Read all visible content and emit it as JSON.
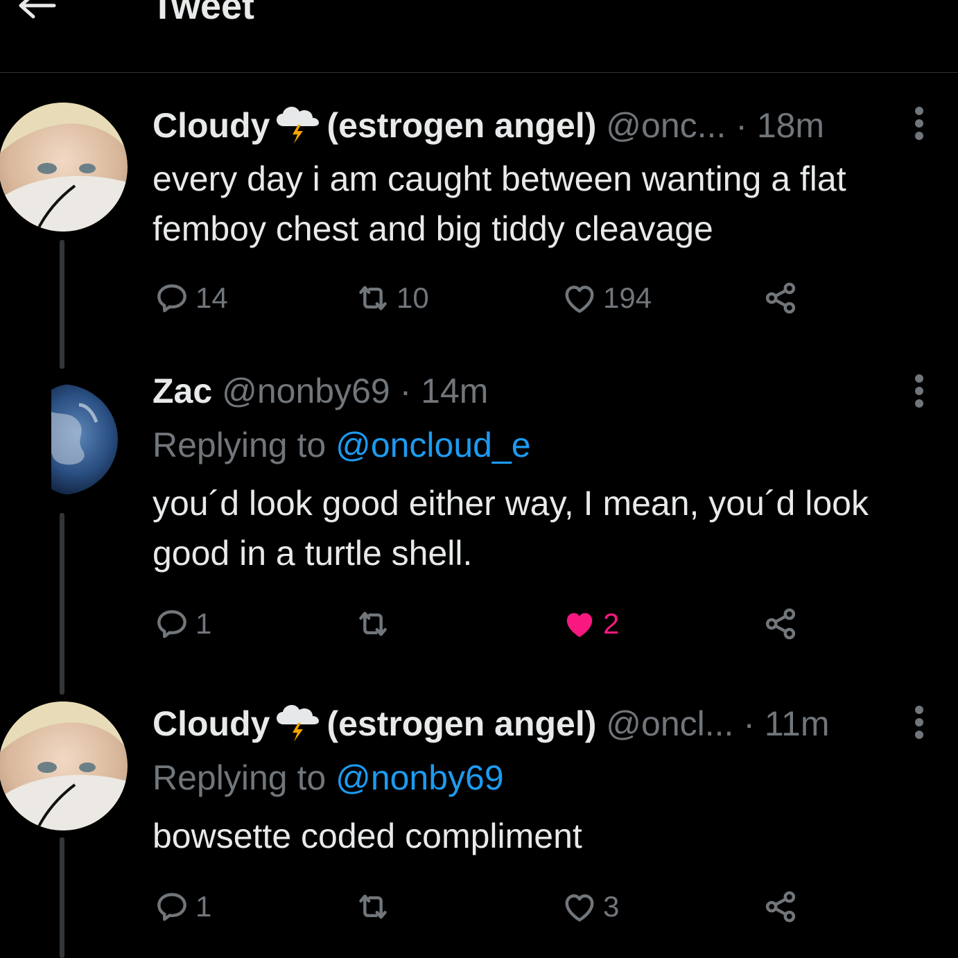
{
  "header": {
    "title": "Tweet"
  },
  "tweets": [
    {
      "name": "Cloudy",
      "name_suffix": "(estrogen angel)",
      "handle": "@onc...",
      "time": "18m",
      "replying_label": "",
      "replying_to": "",
      "text": "every day i am caught between wanting a flat femboy chest and big tiddy cleavage",
      "replies": "14",
      "retweets": "10",
      "likes": "194",
      "liked": false
    },
    {
      "name": "Zac",
      "name_suffix": "",
      "handle": "@nonby69",
      "time": "14m",
      "replying_label": "Replying to",
      "replying_to": "@oncloud_e",
      "text": "you´d look good either way, I mean, you´d look good in a turtle shell.",
      "replies": "1",
      "retweets": "",
      "likes": "2",
      "liked": true
    },
    {
      "name": "Cloudy",
      "name_suffix": "(estrogen angel)",
      "handle": "@oncl...",
      "time": "11m",
      "replying_label": "Replying to",
      "replying_to": "@nonby69",
      "text": "bowsette coded compliment",
      "replies": "1",
      "retweets": "",
      "likes": "3",
      "liked": false
    }
  ],
  "separator": "·",
  "colors": {
    "background": "#000000",
    "text": "#e7e9ea",
    "muted": "#71767b",
    "link": "#1d9bf0",
    "like": "#f91880"
  },
  "icons": [
    "back-arrow-icon",
    "storm-cloud-emoji-icon",
    "more-vertical-icon",
    "reply-icon",
    "retweet-icon",
    "heart-icon",
    "share-icon"
  ]
}
